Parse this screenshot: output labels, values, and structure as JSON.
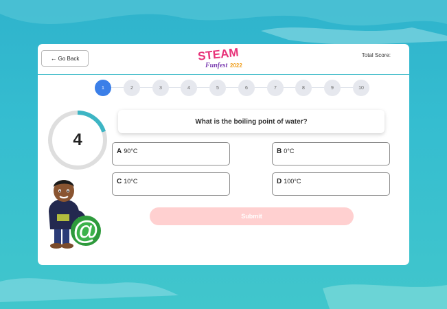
{
  "header": {
    "back_label": "Go Back",
    "logo_title": "STEAM",
    "logo_sub": "Funfest",
    "logo_year": "2022",
    "score_label": "Total Score:"
  },
  "steps": [
    "1",
    "2",
    "3",
    "4",
    "5",
    "6",
    "7",
    "8",
    "9",
    "10"
  ],
  "active_step": 1,
  "timer": {
    "value": "4",
    "progress": 0.2
  },
  "question": {
    "text": "What is the boiling point of water?"
  },
  "options": [
    {
      "letter": "A",
      "text": "90°C"
    },
    {
      "letter": "B",
      "text": "0°C"
    },
    {
      "letter": "C",
      "text": "10°C"
    },
    {
      "letter": "D",
      "text": "100°C"
    }
  ],
  "submit_label": "Submit",
  "colors": {
    "accent": "#3b7fe8",
    "timer_ring": "#3db5c4",
    "submit_disabled": "#ffd0d0",
    "background": "#35bdd0"
  }
}
